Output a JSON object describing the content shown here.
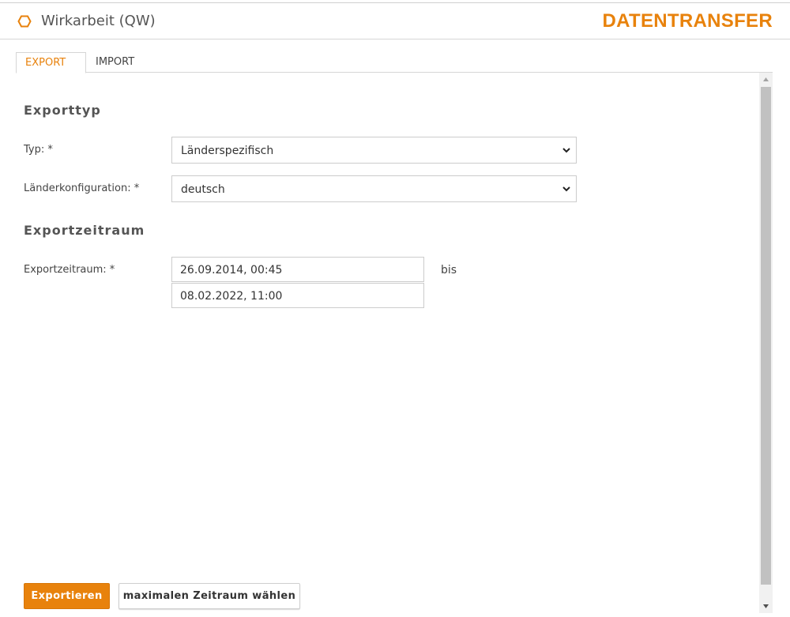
{
  "header": {
    "app_title": "Wirkarbeit (QW)",
    "brand": "DATENTRANSFER",
    "icon": "hexagon-icon",
    "accent_color": "#e8820c"
  },
  "tabs": [
    {
      "label": "EXPORT",
      "active": true
    },
    {
      "label": "IMPORT",
      "active": false
    }
  ],
  "export_type": {
    "section_title": "Exporttyp",
    "typ": {
      "label": "Typ: *",
      "value": "Länderspezifisch"
    },
    "country_config": {
      "label": "Länderkonfiguration: *",
      "value": "deutsch"
    }
  },
  "export_period": {
    "section_title": "Exportzeitraum",
    "label": "Exportzeitraum: *",
    "from": "26.09.2014, 00:45",
    "separator": "bis",
    "to": "08.02.2022, 11:00"
  },
  "actions": {
    "export_label": "Exportieren",
    "max_period_label": "maximalen Zeitraum wählen"
  }
}
